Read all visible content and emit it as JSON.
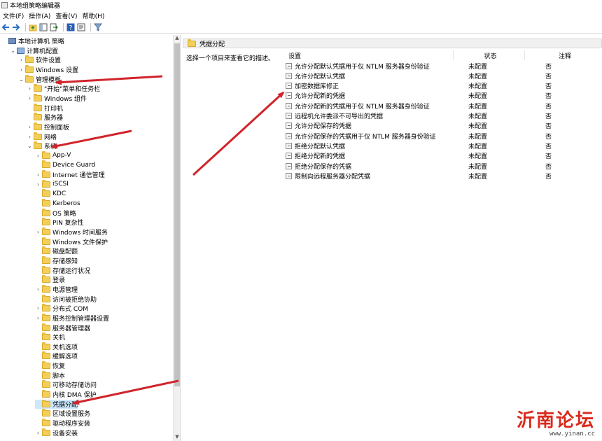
{
  "window": {
    "title": "本地组策略编辑器"
  },
  "menu": [
    "文件(F)",
    "操作(A)",
    "查看(V)",
    "帮助(H)"
  ],
  "toolbar_icons": [
    "back-arrow-icon",
    "forward-arrow-icon",
    "folder-up-icon",
    "show-hide-tree-icon",
    "export-icon",
    "help-icon",
    "properties-icon",
    "filter-icon"
  ],
  "tree": [
    {
      "label": "本地计算机 策略",
      "indent": 0,
      "chev": "",
      "icon": "root"
    },
    {
      "label": "计算机配置",
      "indent": 1,
      "chev": "v",
      "icon": "pc"
    },
    {
      "label": "软件设置",
      "indent": 2,
      "chev": ">",
      "icon": "folder"
    },
    {
      "label": "Windows 设置",
      "indent": 2,
      "chev": ">",
      "icon": "folder"
    },
    {
      "label": "管理模板",
      "indent": 2,
      "chev": "v",
      "icon": "folder"
    },
    {
      "label": "\"开始\"菜单和任务栏",
      "indent": 3,
      "chev": ">",
      "icon": "folder"
    },
    {
      "label": "Windows 组件",
      "indent": 3,
      "chev": ">",
      "icon": "folder"
    },
    {
      "label": "打印机",
      "indent": 3,
      "chev": "",
      "icon": "folder"
    },
    {
      "label": "服务器",
      "indent": 3,
      "chev": "",
      "icon": "folder"
    },
    {
      "label": "控制面板",
      "indent": 3,
      "chev": ">",
      "icon": "folder"
    },
    {
      "label": "网络",
      "indent": 3,
      "chev": ">",
      "icon": "folder"
    },
    {
      "label": "系统",
      "indent": 3,
      "chev": "v",
      "icon": "folder"
    },
    {
      "label": "App-V",
      "indent": 4,
      "chev": ">",
      "icon": "folder"
    },
    {
      "label": "Device Guard",
      "indent": 4,
      "chev": "",
      "icon": "folder"
    },
    {
      "label": "Internet 通信管理",
      "indent": 4,
      "chev": ">",
      "icon": "folder"
    },
    {
      "label": "iSCSI",
      "indent": 4,
      "chev": ">",
      "icon": "folder"
    },
    {
      "label": "KDC",
      "indent": 4,
      "chev": "",
      "icon": "folder"
    },
    {
      "label": "Kerberos",
      "indent": 4,
      "chev": "",
      "icon": "folder"
    },
    {
      "label": "OS 策略",
      "indent": 4,
      "chev": "",
      "icon": "folder"
    },
    {
      "label": "PIN 复杂性",
      "indent": 4,
      "chev": "",
      "icon": "folder"
    },
    {
      "label": "Windows 时间服务",
      "indent": 4,
      "chev": ">",
      "icon": "folder"
    },
    {
      "label": "Windows 文件保护",
      "indent": 4,
      "chev": "",
      "icon": "folder"
    },
    {
      "label": "磁盘配额",
      "indent": 4,
      "chev": "",
      "icon": "folder"
    },
    {
      "label": "存储感知",
      "indent": 4,
      "chev": "",
      "icon": "folder"
    },
    {
      "label": "存储运行状况",
      "indent": 4,
      "chev": "",
      "icon": "folder"
    },
    {
      "label": "登录",
      "indent": 4,
      "chev": "",
      "icon": "folder"
    },
    {
      "label": "电源管理",
      "indent": 4,
      "chev": ">",
      "icon": "folder"
    },
    {
      "label": "访问被拒绝协助",
      "indent": 4,
      "chev": "",
      "icon": "folder"
    },
    {
      "label": "分布式 COM",
      "indent": 4,
      "chev": ">",
      "icon": "folder"
    },
    {
      "label": "服务控制管理器设置",
      "indent": 4,
      "chev": ">",
      "icon": "folder"
    },
    {
      "label": "服务器管理器",
      "indent": 4,
      "chev": "",
      "icon": "folder"
    },
    {
      "label": "关机",
      "indent": 4,
      "chev": "",
      "icon": "folder"
    },
    {
      "label": "关机选项",
      "indent": 4,
      "chev": "",
      "icon": "folder"
    },
    {
      "label": "缓解选项",
      "indent": 4,
      "chev": "",
      "icon": "folder"
    },
    {
      "label": "恢复",
      "indent": 4,
      "chev": "",
      "icon": "folder"
    },
    {
      "label": "脚本",
      "indent": 4,
      "chev": "",
      "icon": "folder"
    },
    {
      "label": "可移动存储访问",
      "indent": 4,
      "chev": "",
      "icon": "folder"
    },
    {
      "label": "内核 DMA 保护",
      "indent": 4,
      "chev": "",
      "icon": "folder"
    },
    {
      "label": "凭据分配",
      "indent": 4,
      "chev": "",
      "icon": "folder",
      "selected": true
    },
    {
      "label": "区域设置服务",
      "indent": 4,
      "chev": "",
      "icon": "folder"
    },
    {
      "label": "驱动程序安装",
      "indent": 4,
      "chev": "",
      "icon": "folder"
    },
    {
      "label": "设备安装",
      "indent": 4,
      "chev": ">",
      "icon": "folder"
    }
  ],
  "right": {
    "header": "凭据分配",
    "description": "选择一个项目来查看它的描述。",
    "columns": {
      "setting": "设置",
      "state": "状态",
      "note": "注释"
    },
    "policies": [
      {
        "name": "允许分配默认凭据用于仅 NTLM 服务器身份验证",
        "state": "未配置",
        "note": "否"
      },
      {
        "name": "允许分配默认凭据",
        "state": "未配置",
        "note": "否"
      },
      {
        "name": "加密数据库修正",
        "state": "未配置",
        "note": "否"
      },
      {
        "name": "允许分配新的凭据",
        "state": "未配置",
        "note": "否"
      },
      {
        "name": "允许分配新的凭据用于仅 NTLM 服务器身份验证",
        "state": "未配置",
        "note": "否"
      },
      {
        "name": "远程机允许委派不可导出的凭据",
        "state": "未配置",
        "note": "否"
      },
      {
        "name": "允许分配保存的凭据",
        "state": "未配置",
        "note": "否"
      },
      {
        "name": "允许分配保存的凭据用于仅 NTLM 服务器身份验证",
        "state": "未配置",
        "note": "否"
      },
      {
        "name": "拒绝分配默认凭据",
        "state": "未配置",
        "note": "否"
      },
      {
        "name": "拒绝分配新的凭据",
        "state": "未配置",
        "note": "否"
      },
      {
        "name": "拒绝分配保存的凭据",
        "state": "未配置",
        "note": "否"
      },
      {
        "name": "限制向远程服务器分配凭据",
        "state": "未配置",
        "note": "否"
      }
    ]
  },
  "annotation_color": "#d0242b",
  "watermark": {
    "text": "沂南论坛",
    "url": "www.yinan.cc",
    "color": "#d92a1c"
  }
}
